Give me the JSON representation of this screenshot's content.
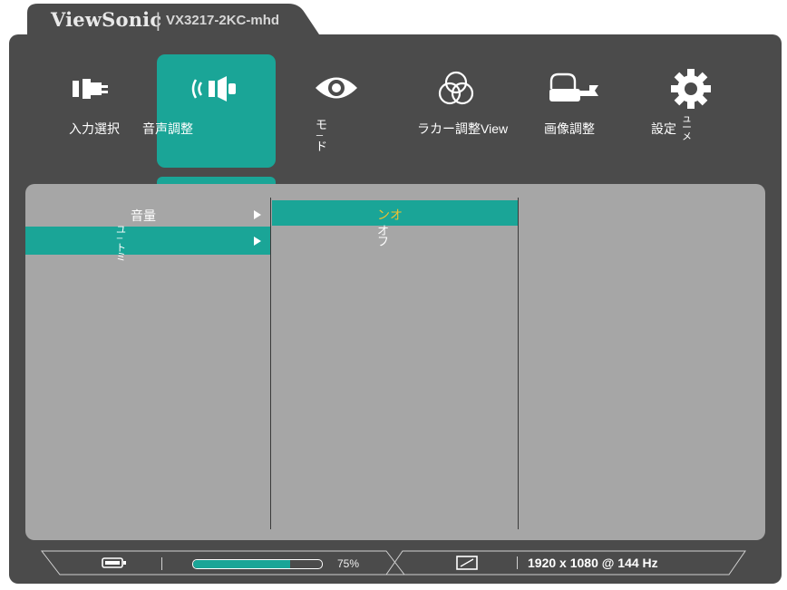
{
  "brand": {
    "name": "ViewSonic",
    "separator": "|",
    "model": "VX3217-2KC-mhd"
  },
  "top_menu": [
    {
      "label": "入力選択",
      "icon": "input-plug-icon"
    },
    {
      "label": "音声調整",
      "icon": "speaker-icon",
      "selected": true
    },
    {
      "label": "モード",
      "icon": "eye-icon"
    },
    {
      "label": "ラカー調整View",
      "icon": "color-circles-icon"
    },
    {
      "label": "画像調整",
      "icon": "hand-wrench-icon"
    },
    {
      "label": "設定ュー",
      "icon": "gear-icon"
    }
  ],
  "mode_label_chars": [
    "モ",
    "ー",
    "ド"
  ],
  "settings_label": {
    "prefix": "設定",
    "suffix_chars": [
      "ュ",
      "ー",
      "メ"
    ]
  },
  "submenu": [
    {
      "label": "音量",
      "selected": false
    },
    {
      "label_chars": [
        "ユ",
        "ー",
        "ト",
        "ミ"
      ],
      "selected": true
    }
  ],
  "options": [
    {
      "label": "ンオ",
      "selected": true
    },
    {
      "label_chars": [
        "オ",
        "フ"
      ],
      "selected": false
    }
  ],
  "status": {
    "progress_percent": 75,
    "progress_text": "75%",
    "resolution": "1920 x 1080 @ 144 Hz"
  },
  "colors": {
    "accent": "#1aa597",
    "selected_text": "#f2c12e",
    "panel": "#a6a6a6",
    "frame": "#4b4b4b"
  }
}
